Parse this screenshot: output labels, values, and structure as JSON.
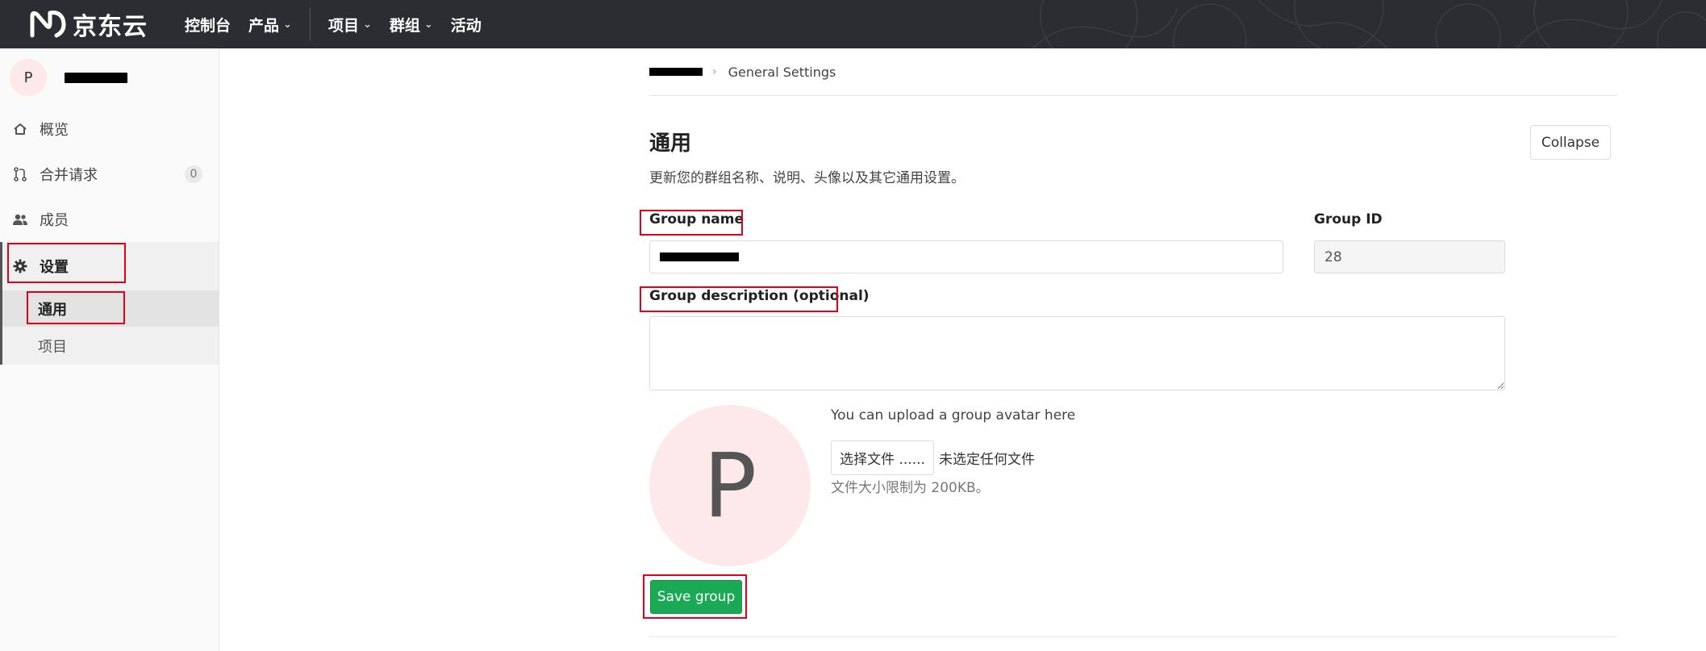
{
  "topbar": {
    "logo_text": "京东云",
    "nav": [
      {
        "label": "控制台",
        "dropdown": false
      },
      {
        "label": "产品",
        "dropdown": true
      },
      {
        "label": "项目",
        "dropdown": true
      },
      {
        "label": "群组",
        "dropdown": true
      },
      {
        "label": "活动",
        "dropdown": false
      }
    ],
    "chevron": "⌄"
  },
  "sidebar": {
    "avatar_letter": "P",
    "items": [
      {
        "label": "概览",
        "icon": "home-icon"
      },
      {
        "label": "合并请求",
        "icon": "merge-request-icon",
        "badge": "0"
      },
      {
        "label": "成员",
        "icon": "users-icon"
      },
      {
        "label": "设置",
        "icon": "gear-icon"
      }
    ],
    "sub_items": [
      {
        "label": "通用"
      },
      {
        "label": "项目"
      }
    ]
  },
  "breadcrumb": {
    "current": "General Settings",
    "separator": "›"
  },
  "section": {
    "title": "通用",
    "description": "更新您的群组名称、说明、头像以及其它通用设置。",
    "collapse_label": "Collapse"
  },
  "form": {
    "group_name_label": "Group name",
    "group_id_label": "Group ID",
    "group_id_value": "28",
    "description_label": "Group description (optional)",
    "avatar_letter": "P",
    "upload_text": "You can upload a group avatar here",
    "file_button_label": "选择文件 ......",
    "file_status": "未选定任何文件",
    "file_limit": "文件大小限制为 200KB。",
    "save_label": "Save group"
  },
  "colors": {
    "topbar_bg": "#2b2d33",
    "save_green": "#1aaa55",
    "highlight_red": "#e3001b",
    "avatar_bg": "#fde8ea"
  }
}
